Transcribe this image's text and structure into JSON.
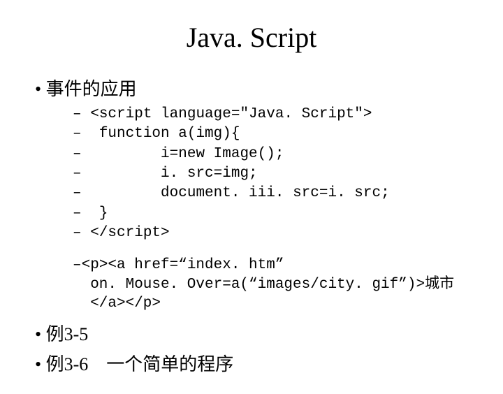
{
  "title": "Java. Script",
  "bullet1": "事件的应用",
  "code": {
    "l1": "<script language=\"Java. Script\">",
    "l2": " function a(img){",
    "l3": "        i=new Image();",
    "l4": "        i. src=img;",
    "l5": "        document. iii. src=i. src;",
    "l6": " }",
    "l7": "</script>"
  },
  "snippet": {
    "line1": "<p><a href=“index. htm”",
    "line2": "on. Mouse. Over=a(“images/city. gif”)>城市</a></p>"
  },
  "bullet2": "例3-5",
  "bullet3_a": "例3-6",
  "bullet3_b": "一个简单的程序"
}
